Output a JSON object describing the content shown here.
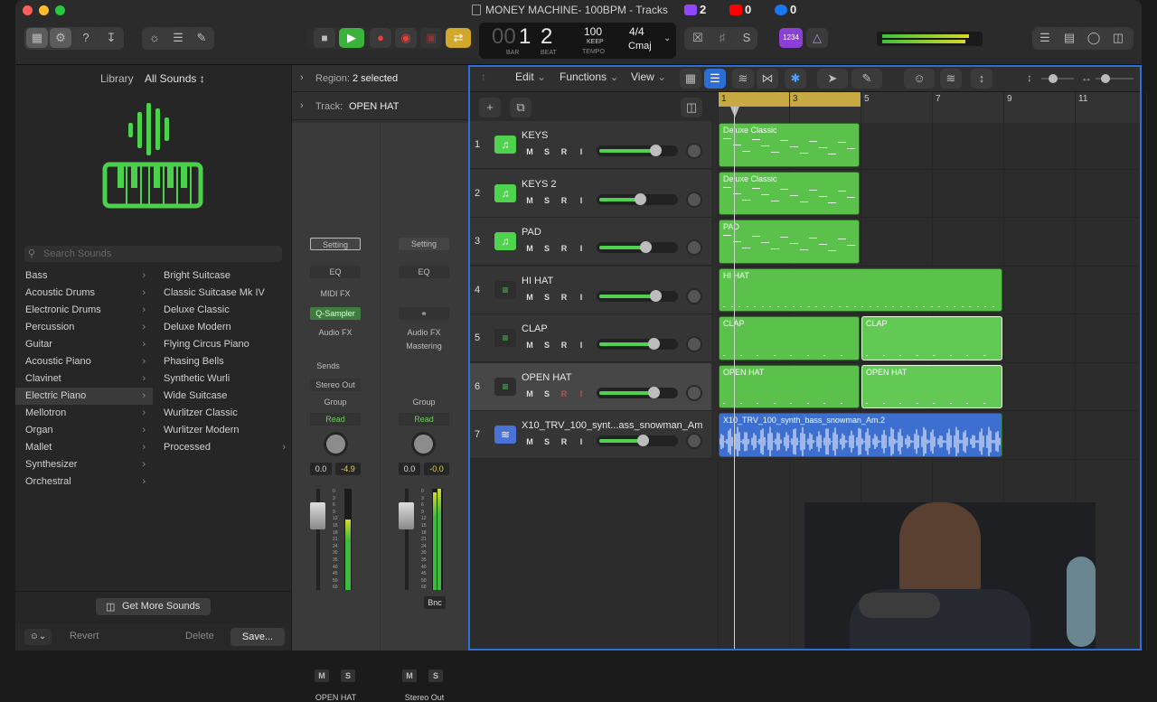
{
  "window": {
    "title": "MONEY MACHINE- 100BPM - Tracks"
  },
  "social": {
    "twitch": "2",
    "youtube": "0",
    "facebook": "0"
  },
  "lcd": {
    "bar": "1",
    "beat": "2",
    "bar_label": "BAR",
    "beat_label": "BEAT",
    "tempo": "100",
    "tempo_mode": "KEEP",
    "tempo_label": "TEMPO",
    "signature": "4/4",
    "key": "Cmaj",
    "count_in": "1234"
  },
  "library": {
    "title": "Library",
    "filter": "All Sounds ↕",
    "search_placeholder": "Search Sounds",
    "categories": [
      "Bass",
      "Acoustic Drums",
      "Electronic Drums",
      "Percussion",
      "Guitar",
      "Acoustic Piano",
      "Clavinet",
      "Electric Piano",
      "Mellotron",
      "Organ",
      "Mallet",
      "Synthesizer",
      "Orchestral"
    ],
    "sounds": [
      "Bright Suitcase",
      "Classic Suitcase Mk IV",
      "Deluxe Classic",
      "Deluxe Modern",
      "Flying Circus Piano",
      "Phasing Bells",
      "Synthetic Wurli",
      "Wide Suitcase",
      "Wurlitzer Classic",
      "Wurlitzer Modern",
      "Processed"
    ],
    "get_more": "Get More Sounds",
    "revert": "Revert",
    "delete": "Delete",
    "save": "Save..."
  },
  "inspector": {
    "region_label": "Region:",
    "region_value": "2 selected",
    "track_label": "Track:",
    "track_value": "OPEN HAT",
    "strip1": {
      "setting": "Setting",
      "eq": "EQ",
      "midi_fx": "MIDI FX",
      "instrument": "Q-Sampler",
      "audio_fx": "Audio FX",
      "sends": "Sends",
      "output": "Stereo Out",
      "group": "Group",
      "read": "Read",
      "vol": "0.0",
      "peak": "-4.9",
      "m": "M",
      "s": "S",
      "name": "OPEN HAT"
    },
    "strip2": {
      "setting": "Setting",
      "eq": "EQ",
      "audio_fx": "Audio FX",
      "mastering": "Mastering",
      "group": "Group",
      "read": "Read",
      "vol": "0.0",
      "peak": "-0.0",
      "bnc": "Bnc",
      "m": "M",
      "s": "S",
      "name": "Stereo Out"
    },
    "meter_ticks": [
      "0",
      "3",
      "6",
      "9",
      "12",
      "15",
      "18",
      "21",
      "24",
      "30",
      "35",
      "40",
      "45",
      "50",
      "60"
    ]
  },
  "tracks_toolbar": {
    "edit": "Edit",
    "functions": "Functions",
    "view": "View"
  },
  "ruler": [
    "1",
    "3",
    "5",
    "7",
    "9",
    "11"
  ],
  "tracks": [
    {
      "num": "1",
      "name": "KEYS",
      "kind": "midi",
      "vol": 0.75,
      "regions": [
        {
          "name": "Deluxe Classic",
          "start": 1,
          "end": 5
        }
      ]
    },
    {
      "num": "2",
      "name": "KEYS 2",
      "kind": "midi",
      "vol": 0.55,
      "regions": [
        {
          "name": "Deluxe Classic",
          "start": 1,
          "end": 5
        }
      ]
    },
    {
      "num": "3",
      "name": "PAD",
      "kind": "midi",
      "vol": 0.62,
      "regions": [
        {
          "name": "PAD",
          "start": 1,
          "end": 5
        }
      ]
    },
    {
      "num": "4",
      "name": "HI HAT",
      "kind": "drum",
      "vol": 0.75,
      "regions": [
        {
          "name": "HI HAT",
          "start": 1,
          "end": 9
        }
      ]
    },
    {
      "num": "5",
      "name": "CLAP",
      "kind": "drum",
      "vol": 0.73,
      "regions": [
        {
          "name": "CLAP",
          "start": 1,
          "end": 5
        },
        {
          "name": "CLAP",
          "start": 5,
          "end": 9,
          "selected": true
        }
      ]
    },
    {
      "num": "6",
      "name": "OPEN HAT",
      "kind": "drum",
      "vol": 0.73,
      "selected": true,
      "regions": [
        {
          "name": "OPEN HAT",
          "start": 1,
          "end": 5
        },
        {
          "name": "OPEN HAT",
          "start": 5,
          "end": 9,
          "selected": true
        }
      ]
    },
    {
      "num": "7",
      "name": "X10_TRV_100_synt...ass_snowman_Am",
      "kind": "audio",
      "vol": 0.58,
      "regions": [
        {
          "name": "X10_TRV_100_synth_bass_snowman_Am.2",
          "start": 1,
          "end": 9
        }
      ]
    }
  ],
  "colors": {
    "green": "#4fd34f",
    "region_green": "#5ac24a",
    "audio_blue": "#3d6fd0",
    "yellow": "#e6c04a",
    "blue_accent": "#2b6fd6"
  }
}
